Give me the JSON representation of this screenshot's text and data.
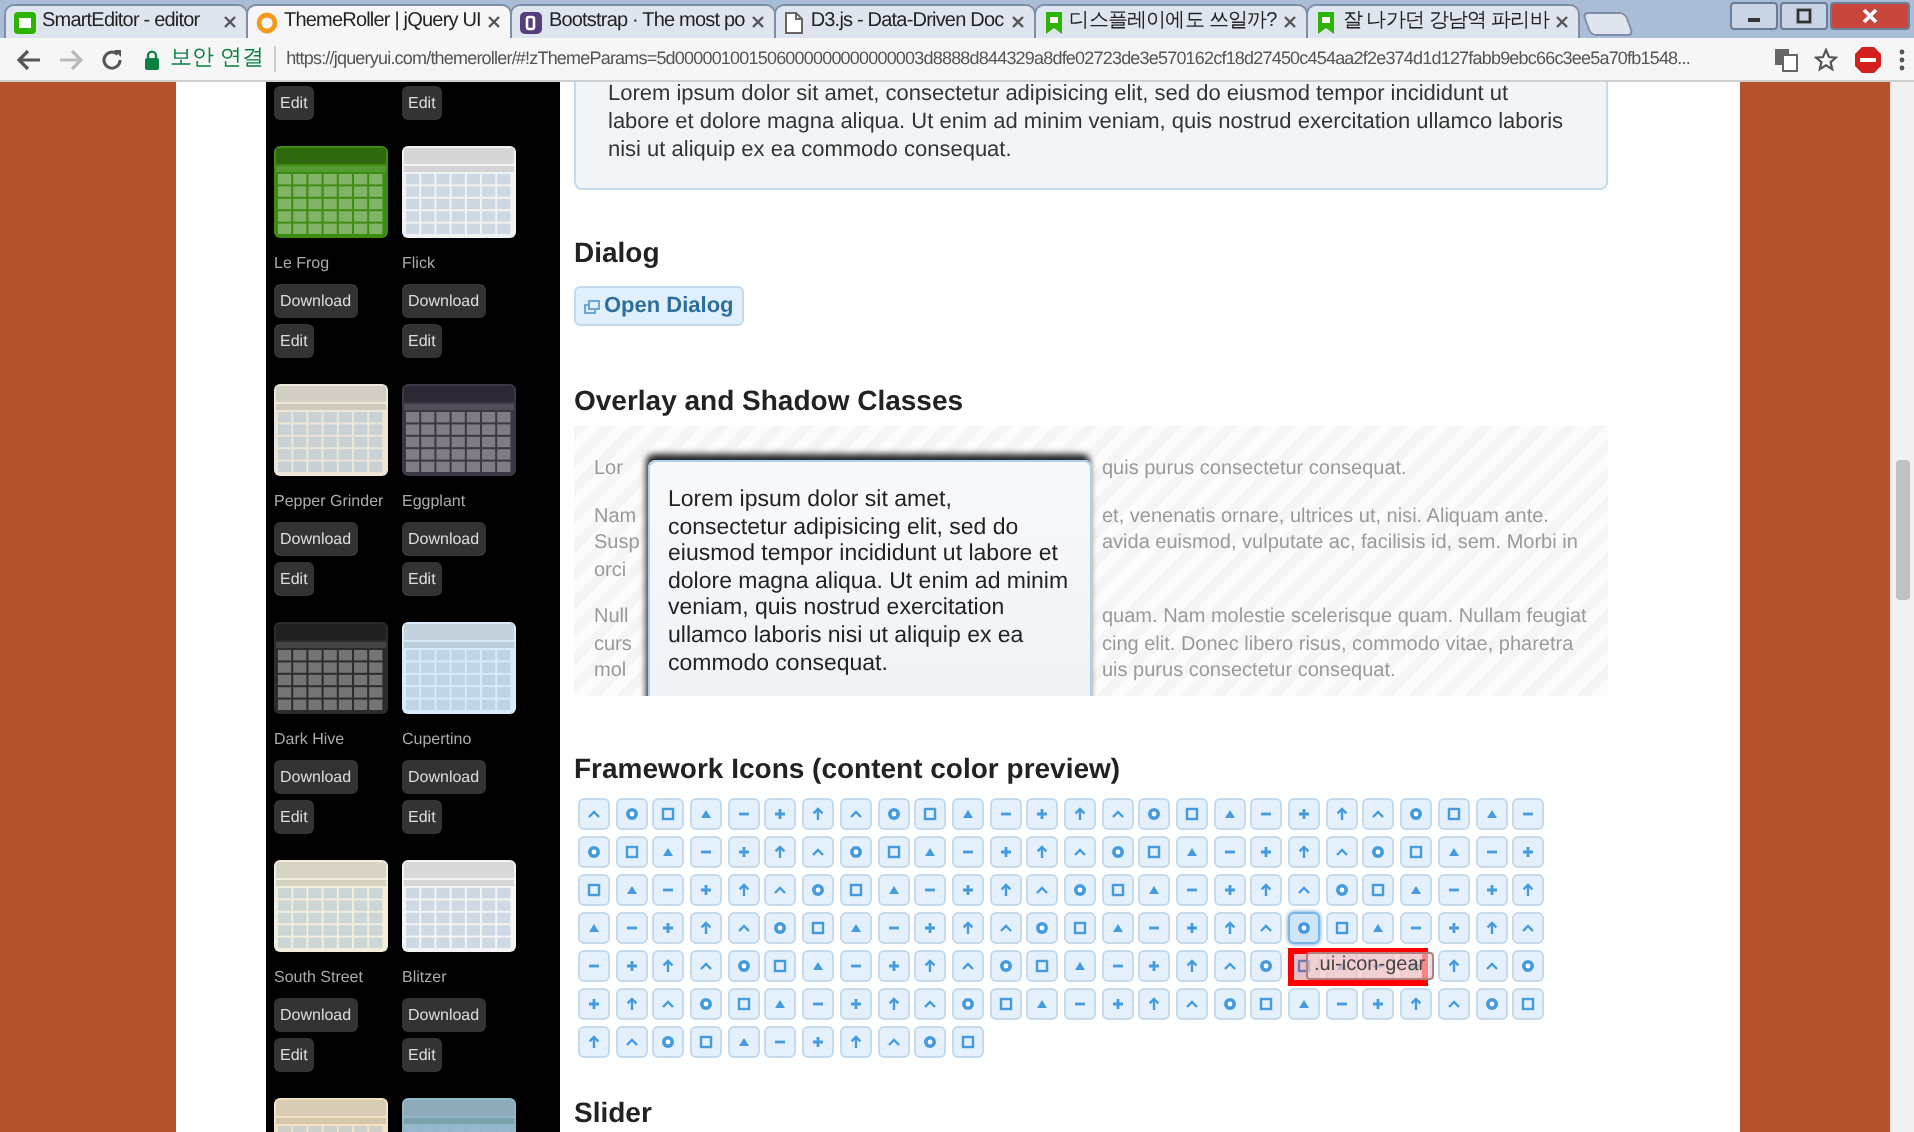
{
  "browser": {
    "tabs": [
      {
        "title": "SmartEditor - editor",
        "kind": "editor",
        "selected": false
      },
      {
        "title": "ThemeRoller | jQuery UI",
        "kind": "ring",
        "selected": true
      },
      {
        "title": "Bootstrap · The most po",
        "kind": "square",
        "selected": false
      },
      {
        "title": "D3.js - Data-Driven Doc",
        "kind": "document",
        "selected": false
      },
      {
        "title": "디스플레이에도 쓰일까?",
        "kind": "bookmark",
        "selected": false
      },
      {
        "title": "잘 나가던 강남역 파리바",
        "kind": "bookmark",
        "selected": false
      }
    ],
    "security_label": "보안 연결",
    "url": "https://jqueryui.com/themeroller/#!zThemeParams=5d000001001506000000000000003d8888d844329a8dfe02723de3e570162cf18d27450c454aa2f2e374d1d127fabb9ebc66c3ee5a70fb1548..."
  },
  "sidebar": {
    "themes": [
      {
        "edit": "Edit"
      },
      {
        "edit": "Edit"
      },
      {
        "color": "#3e8c14",
        "name": "Le Frog",
        "download": "Download",
        "edit": "Edit"
      },
      {
        "color": "#f2f2f2",
        "name": "Flick",
        "download": "Download",
        "edit": "Edit"
      },
      {
        "color": "#ece6d8",
        "name": "Pepper Grinder",
        "download": "Download",
        "edit": "Edit"
      },
      {
        "color": "#3d3644",
        "name": "Eggplant",
        "download": "Download",
        "edit": "Edit"
      },
      {
        "color": "#2c2c2c",
        "name": "Dark Hive",
        "download": "Download",
        "edit": "Edit"
      },
      {
        "color": "#d7ebf9",
        "name": "Cupertino",
        "download": "Download",
        "edit": "Edit"
      },
      {
        "color": "#f2eedb",
        "name": "South Street",
        "download": "Download",
        "edit": "Edit"
      },
      {
        "color": "#f4f4f4",
        "name": "Blitzer",
        "download": "Download",
        "edit": "Edit"
      },
      {
        "color": "#f3e3c4"
      },
      {
        "color": "#8fb7c8"
      }
    ]
  },
  "content": {
    "intro_text": "Lorem ipsum dolor sit amet, consectetur adipisicing elit, sed do eiusmod tempor incididunt ut labore et dolore magna aliqua. Ut enim ad minim veniam, quis nostrud exercitation ullamco laboris nisi ut aliquip ex ea commodo consequat.",
    "dialog": {
      "heading": "Dialog",
      "button": "Open Dialog"
    },
    "overlay": {
      "heading": "Overlay and Shadow Classes",
      "paragraphs": [
        [
          {
            "left": "Lor",
            "right": "quis purus consectetur consequat."
          }
        ],
        [
          {
            "left": "Nam",
            "right": "et, venenatis ornare, ultrices ut, nisi. Aliquam ante."
          },
          {
            "left": "Susp",
            "right": "avida euismod, vulputate ac, facilisis id, sem. Morbi in"
          },
          {
            "left": "orci"
          }
        ],
        [
          {
            "left": "Null",
            "right": "quam. Nam molestie scelerisque quam. Nullam feugiat"
          },
          {
            "left": "curs",
            "right": "cing elit. Donec libero risus, commodo vitae, pharetra"
          },
          {
            "left": "mol",
            "right": "uis purus consectetur consequat."
          }
        ]
      ],
      "dialog_text": "Lorem ipsum dolor sit amet, consectetur adipisicing elit, sed do eiusmod tempor incididunt ut labore et dolore magna aliqua. Ut enim ad minim veniam, quis nostrud exercitation ullamco laboris nisi ut aliquip ex ea commodo consequat."
    },
    "icons": {
      "heading": "Framework Icons (content color preview)",
      "tooltip": ".ui-icon-gear",
      "tiles": [
        {
          "selected": false
        },
        {
          "selected": false
        },
        {
          "selected": false
        },
        {
          "selected": false
        },
        {
          "selected": false
        },
        {
          "selected": false
        },
        {
          "selected": false
        },
        {
          "selected": false
        },
        {
          "selected": false
        },
        {
          "selected": false
        },
        {
          "selected": false
        },
        {
          "selected": false
        },
        {
          "selected": false
        },
        {
          "selected": false
        },
        {
          "selected": false
        },
        {
          "selected": false
        },
        {
          "selected": false
        },
        {
          "selected": false
        },
        {
          "selected": false
        },
        {
          "selected": false
        },
        {
          "selected": false
        },
        {
          "selected": false
        },
        {
          "selected": false
        },
        {
          "selected": false
        },
        {
          "selected": false
        },
        {
          "selected": false
        },
        {
          "selected": false
        },
        {
          "selected": false
        },
        {
          "selected": false
        },
        {
          "selected": false
        },
        {
          "selected": false
        },
        {
          "selected": false
        },
        {
          "selected": false
        },
        {
          "selected": false
        },
        {
          "selected": false
        },
        {
          "selected": false
        },
        {
          "selected": false
        },
        {
          "selected": false
        },
        {
          "selected": false
        },
        {
          "selected": false
        },
        {
          "selected": false
        },
        {
          "selected": false
        },
        {
          "selected": false
        },
        {
          "selected": false
        },
        {
          "selected": false
        },
        {
          "selected": false
        },
        {
          "selected": false
        },
        {
          "selected": false
        },
        {
          "selected": false
        },
        {
          "selected": false
        },
        {
          "selected": false
        },
        {
          "selected": false
        },
        {
          "selected": false
        },
        {
          "selected": false
        },
        {
          "selected": false
        },
        {
          "selected": false
        },
        {
          "selected": false
        },
        {
          "selected": false
        },
        {
          "selected": false
        },
        {
          "selected": false
        },
        {
          "selected": false
        },
        {
          "selected": false
        },
        {
          "selected": false
        },
        {
          "selected": false
        },
        {
          "selected": false
        },
        {
          "selected": false
        },
        {
          "selected": false
        },
        {
          "selected": false
        },
        {
          "selected": false
        },
        {
          "selected": false
        },
        {
          "selected": false
        },
        {
          "selected": false
        },
        {
          "selected": false
        },
        {
          "selected": false
        },
        {
          "selected": false
        },
        {
          "selected": false
        },
        {
          "selected": false
        },
        {
          "selected": false
        },
        {
          "selected": false
        },
        {
          "selected": false
        },
        {
          "selected": false
        },
        {
          "selected": false
        },
        {
          "selected": false
        },
        {
          "selected": false
        },
        {
          "selected": false
        },
        {
          "selected": false
        },
        {
          "selected": false
        },
        {
          "selected": false
        },
        {
          "selected": false
        },
        {
          "selected": false
        },
        {
          "selected": false
        },
        {
          "selected": false
        },
        {
          "selected": false
        },
        {
          "selected": false
        },
        {
          "selected": false
        },
        {
          "selected": false
        },
        {
          "selected": false
        },
        {
          "selected": true
        },
        {
          "selected": false
        },
        {
          "selected": false
        },
        {
          "selected": false
        },
        {
          "selected": false
        },
        {
          "selected": false
        },
        {
          "selected": false
        },
        {
          "selected": false
        },
        {
          "selected": false
        },
        {
          "selected": false
        },
        {
          "selected": false
        },
        {
          "selected": false
        },
        {
          "selected": false
        },
        {
          "selected": false
        },
        {
          "selected": false
        },
        {
          "selected": false
        },
        {
          "selected": false
        },
        {
          "selected": false
        },
        {
          "selected": false
        },
        {
          "selected": false
        },
        {
          "selected": false
        },
        {
          "selected": false
        },
        {
          "selected": false
        },
        {
          "selected": false
        },
        {
          "selected": false
        },
        {
          "selected": false
        },
        {
          "selected": false
        },
        {
          "selected": false
        },
        {
          "selected": false
        },
        {
          "selected": false
        },
        {
          "selected": false
        },
        {
          "selected": false
        },
        {
          "selected": false
        },
        {
          "selected": false
        },
        {
          "selected": false
        },
        {
          "selected": false
        },
        {
          "selected": false
        },
        {
          "selected": false
        },
        {
          "selected": false
        },
        {
          "selected": false
        },
        {
          "selected": false
        },
        {
          "selected": false
        },
        {
          "selected": false
        },
        {
          "selected": false
        },
        {
          "selected": false
        },
        {
          "selected": false
        },
        {
          "selected": false
        },
        {
          "selected": false
        },
        {
          "selected": false
        },
        {
          "selected": false
        },
        {
          "selected": false
        },
        {
          "selected": false
        },
        {
          "selected": false
        },
        {
          "selected": false
        },
        {
          "selected": false
        },
        {
          "selected": false
        },
        {
          "selected": false
        },
        {
          "selected": false
        },
        {
          "selected": false
        },
        {
          "selected": false
        },
        {
          "selected": false
        },
        {
          "selected": false
        },
        {
          "selected": false
        },
        {
          "selected": false
        },
        {
          "selected": false
        },
        {
          "selected": false
        },
        {
          "selected": false
        },
        {
          "selected": false
        },
        {
          "selected": false
        },
        {
          "selected": false
        }
      ]
    },
    "slider": {
      "heading": "Slider"
    }
  }
}
